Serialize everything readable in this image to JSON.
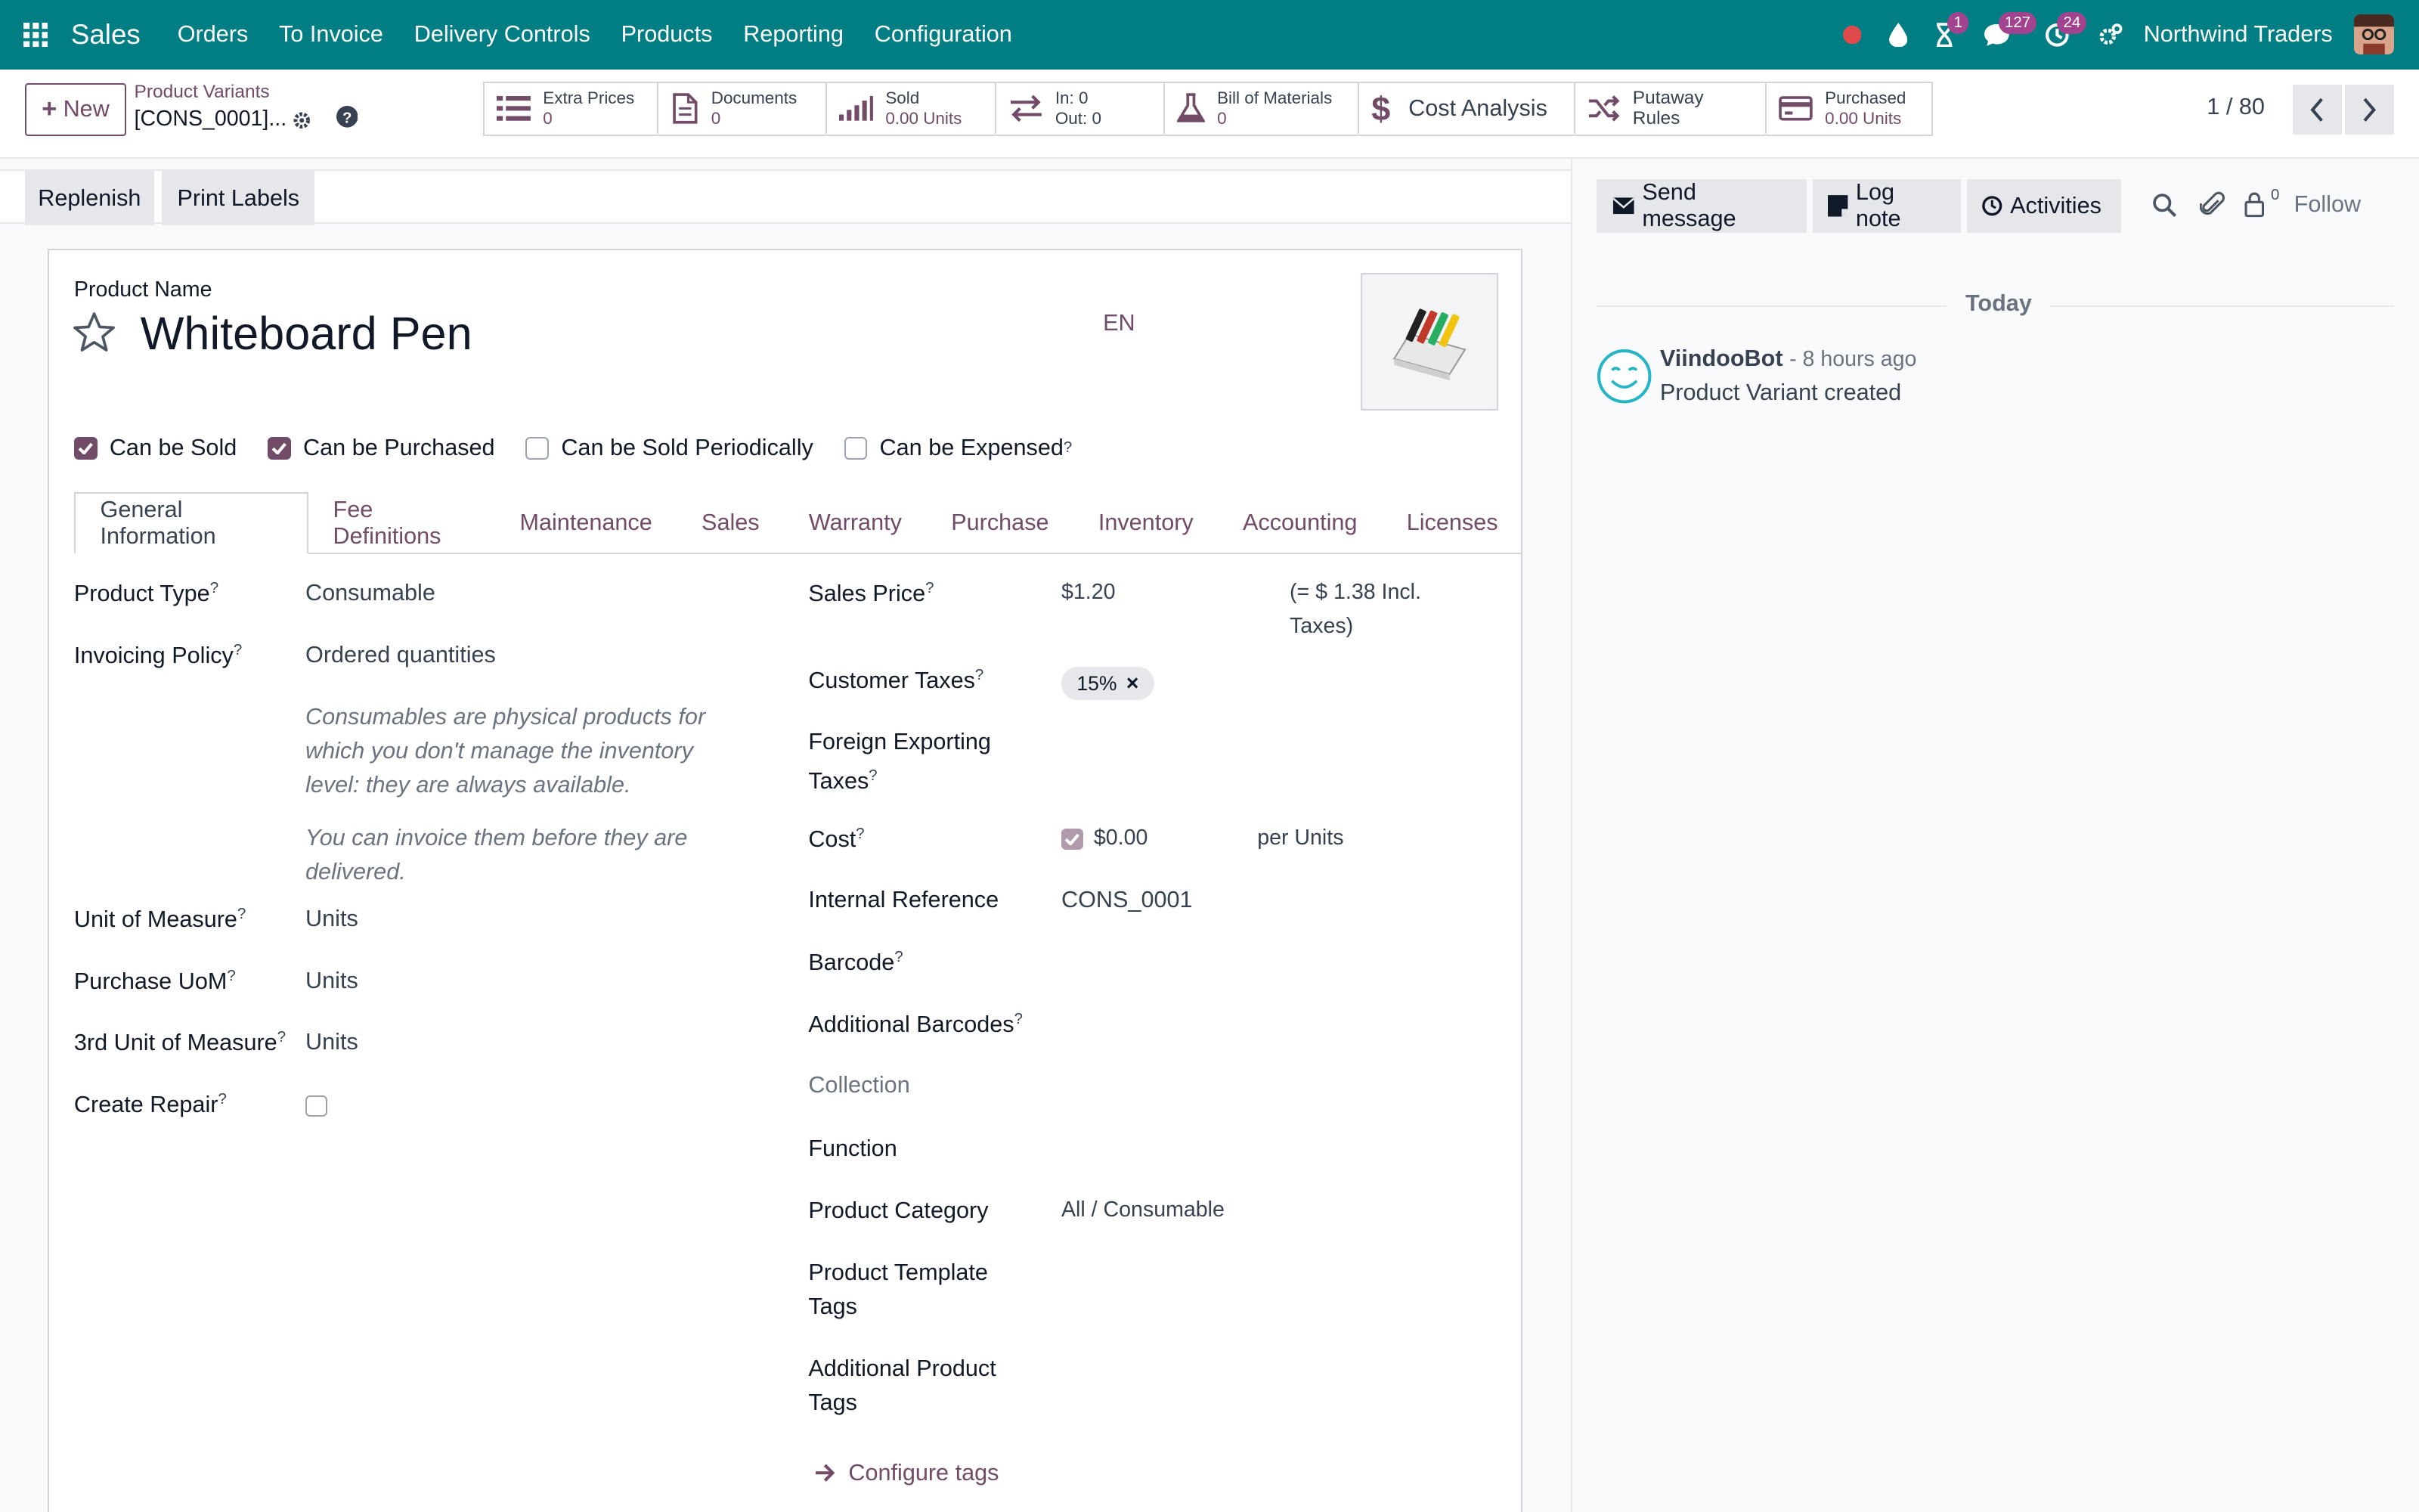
{
  "navbar": {
    "app": "Sales",
    "menus": [
      "Orders",
      "To Invoice",
      "Delivery Controls",
      "Products",
      "Reporting",
      "Configuration"
    ],
    "activity_badge": "1",
    "messages_badge": "127",
    "clock_badge": "24",
    "company": "Northwind Traders"
  },
  "control": {
    "new_label": "New",
    "breadcrumb_parent": "Product Variants",
    "breadcrumb_current": "[CONS_0001]...",
    "smart": {
      "extra_prices": {
        "label": "Extra Prices",
        "value": "0"
      },
      "documents": {
        "label": "Documents",
        "value": "0"
      },
      "sold": {
        "label": "Sold",
        "value": "0.00 Units"
      },
      "inout": {
        "in": "In: 0",
        "out": "Out: 0"
      },
      "bom": {
        "label": "Bill of Materials",
        "value": "0"
      },
      "cost": "Cost Analysis",
      "putaway": "Putaway Rules",
      "purchased": {
        "label": "Purchased",
        "value": "0.00 Units"
      }
    },
    "pager": "1 / 80"
  },
  "actions": {
    "replenish": "Replenish",
    "print_labels": "Print Labels"
  },
  "form": {
    "product_name_label": "Product Name",
    "product_name": "Whiteboard Pen",
    "lang": "EN",
    "checks": {
      "sold": "Can be Sold",
      "purchased": "Can be Purchased",
      "periodic": "Can be Sold Periodically",
      "expensed": "Can be Expensed"
    },
    "tabs": [
      "General Information",
      "Fee Definitions",
      "Maintenance",
      "Sales",
      "Warranty",
      "Purchase",
      "Inventory",
      "Accounting",
      "Licenses"
    ],
    "left": {
      "product_type_label": "Product Type",
      "product_type": "Consumable",
      "invoicing_label": "Invoicing Policy",
      "invoicing": "Ordered quantities",
      "help1": "Consumables are physical products for which you don't manage the inventory level: they are always available.",
      "help2": "You can invoice them before they are delivered.",
      "uom_label": "Unit of Measure",
      "uom": "Units",
      "purchase_uom_label": "Purchase UoM",
      "purchase_uom": "Units",
      "third_uom_label": "3rd Unit of Measure",
      "third_uom": "Units",
      "create_repair_label": "Create Repair"
    },
    "right": {
      "sales_price_label": "Sales Price",
      "sales_price": "$1.20",
      "incl_taxes": "(= $ 1.38 Incl. Taxes)",
      "customer_taxes_label": "Customer Taxes",
      "customer_tax": "15%",
      "foreign_taxes_label": "Foreign Exporting Taxes",
      "cost_label": "Cost",
      "cost": "$0.00",
      "per_units": "per Units",
      "internal_ref_label": "Internal Reference",
      "internal_ref": "CONS_0001",
      "barcode_label": "Barcode",
      "add_barcodes_label": "Additional Barcodes",
      "collection_label": "Collection",
      "function_label": "Function",
      "category_label": "Product Category",
      "category": "All / Consumable",
      "template_tags_label": "Product Template Tags",
      "additional_tags_label": "Additional Product Tags",
      "configure_tags": "Configure tags"
    }
  },
  "chatter": {
    "send_message": "Send message",
    "log_note": "Log note",
    "activities": "Activities",
    "followers_count": "0",
    "follow": "Follow",
    "today": "Today",
    "author": "ViindooBot",
    "time": "- 8 hours ago",
    "message": "Product Variant created"
  },
  "colors": {
    "navbar": "#017e84",
    "accent": "#714b67",
    "badge": "#a2438f"
  }
}
